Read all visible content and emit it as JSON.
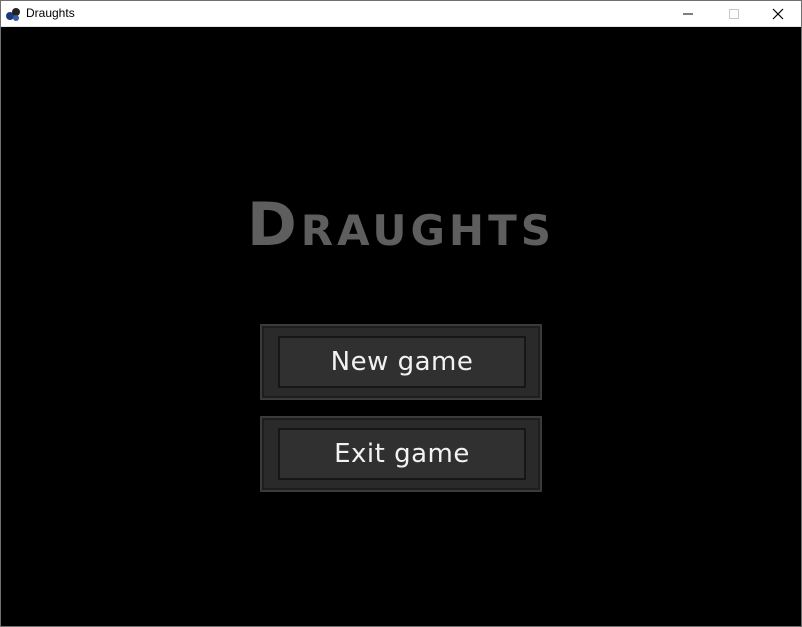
{
  "window": {
    "title": "Draughts",
    "app_icon": "draughts-app-icon",
    "controls": {
      "minimize_icon": "minimize-icon",
      "maximize_icon": "maximize-icon",
      "close_icon": "close-icon"
    }
  },
  "game": {
    "title": "Draughts",
    "title_color": "#5e5e5e",
    "menu": {
      "new_game_label": "New game",
      "exit_game_label": "Exit game"
    },
    "background_color": "#000000",
    "button_color": "#2f2f2f"
  }
}
